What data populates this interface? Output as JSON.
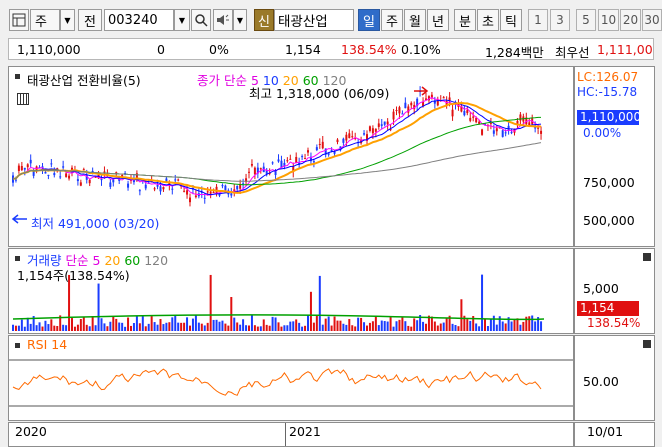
{
  "toolbar": {
    "mode_label": "주",
    "jeon_label": "전",
    "stock_code": "003240",
    "sin_label": "신",
    "stock_name": "태광산업",
    "period_buttons": [
      "일",
      "주",
      "월",
      "년"
    ],
    "unit_buttons": [
      "분",
      "초",
      "틱"
    ],
    "number_buttons": [
      "1",
      "3",
      "5",
      "10",
      "20",
      "30"
    ]
  },
  "info": {
    "price": "1,110,000",
    "change": "0",
    "change_pct": "0%",
    "volume": "1,154",
    "volume_ratio": "138.54%",
    "turnover": "0.10%",
    "amount": "1,284백만",
    "best_ask_label": "최우선",
    "best_ask_value": "1,111,00"
  },
  "price_panel": {
    "title": "태광산업 전환비율(5)",
    "indicator": "종가 단순",
    "ma_periods": [
      "5",
      "10",
      "20",
      "60",
      "120"
    ],
    "high_annotation": "최고 1,318,000 (06/09)",
    "low_annotation": "최저 491,000 (03/20)",
    "lc": "LC:126.07",
    "hc": "HC:-15.78",
    "current_price": "1,110,000",
    "current_pct": "0.00%",
    "ticks": [
      "750,000",
      "500,000"
    ]
  },
  "volume_panel": {
    "title": "거래량",
    "indicator": "단순",
    "ma_periods": [
      "5",
      "20",
      "60",
      "120"
    ],
    "subtitle": "1,154주(138.54%)",
    "tick": "5,000",
    "current_volume": "1,154",
    "current_pct": "138.54%"
  },
  "rsi_panel": {
    "title": "RSI 14",
    "tick": "50.00"
  },
  "xaxis": {
    "labels": [
      "2020",
      "2021"
    ],
    "right_date": "10/01"
  },
  "colors": {
    "up": "#e01010",
    "down": "#1a3cff",
    "ma5": "#ff00ff",
    "ma10": "#0000ff",
    "ma20": "#ffa000",
    "ma60": "#00a000",
    "ma120": "#808080",
    "rsi": "#ff6a00",
    "accent": "#2f6cc9"
  }
}
